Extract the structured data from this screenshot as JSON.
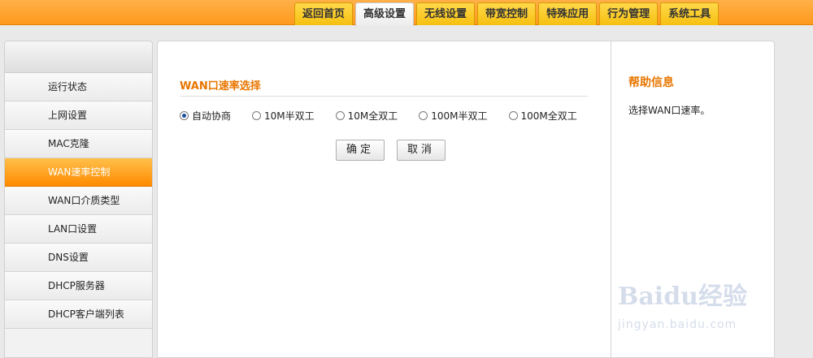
{
  "nav": {
    "tabs": [
      "返回首页",
      "高级设置",
      "无线设置",
      "带宽控制",
      "特殊应用",
      "行为管理",
      "系统工具"
    ],
    "active_index": 1
  },
  "sidebar": {
    "items": [
      "运行状态",
      "上网设置",
      "MAC克隆",
      "WAN速率控制",
      "WAN口介质类型",
      "LAN口设置",
      "DNS设置",
      "DHCP服务器",
      "DHCP客户端列表"
    ],
    "active_index": 3
  },
  "main": {
    "section_title": "WAN口速率选择",
    "options": [
      "自动协商",
      "10M半双工",
      "10M全双工",
      "100M半双工",
      "100M全双工"
    ],
    "selected_index": 0,
    "ok_label": "确定",
    "cancel_label": "取消"
  },
  "help": {
    "title": "帮助信息",
    "text": "选择WAN口速率。"
  },
  "watermark": {
    "logo": "Baidu经验",
    "url": "jingyan.baidu.com"
  },
  "colors": {
    "accent": "#ff9a1c",
    "title": "#e87600"
  }
}
